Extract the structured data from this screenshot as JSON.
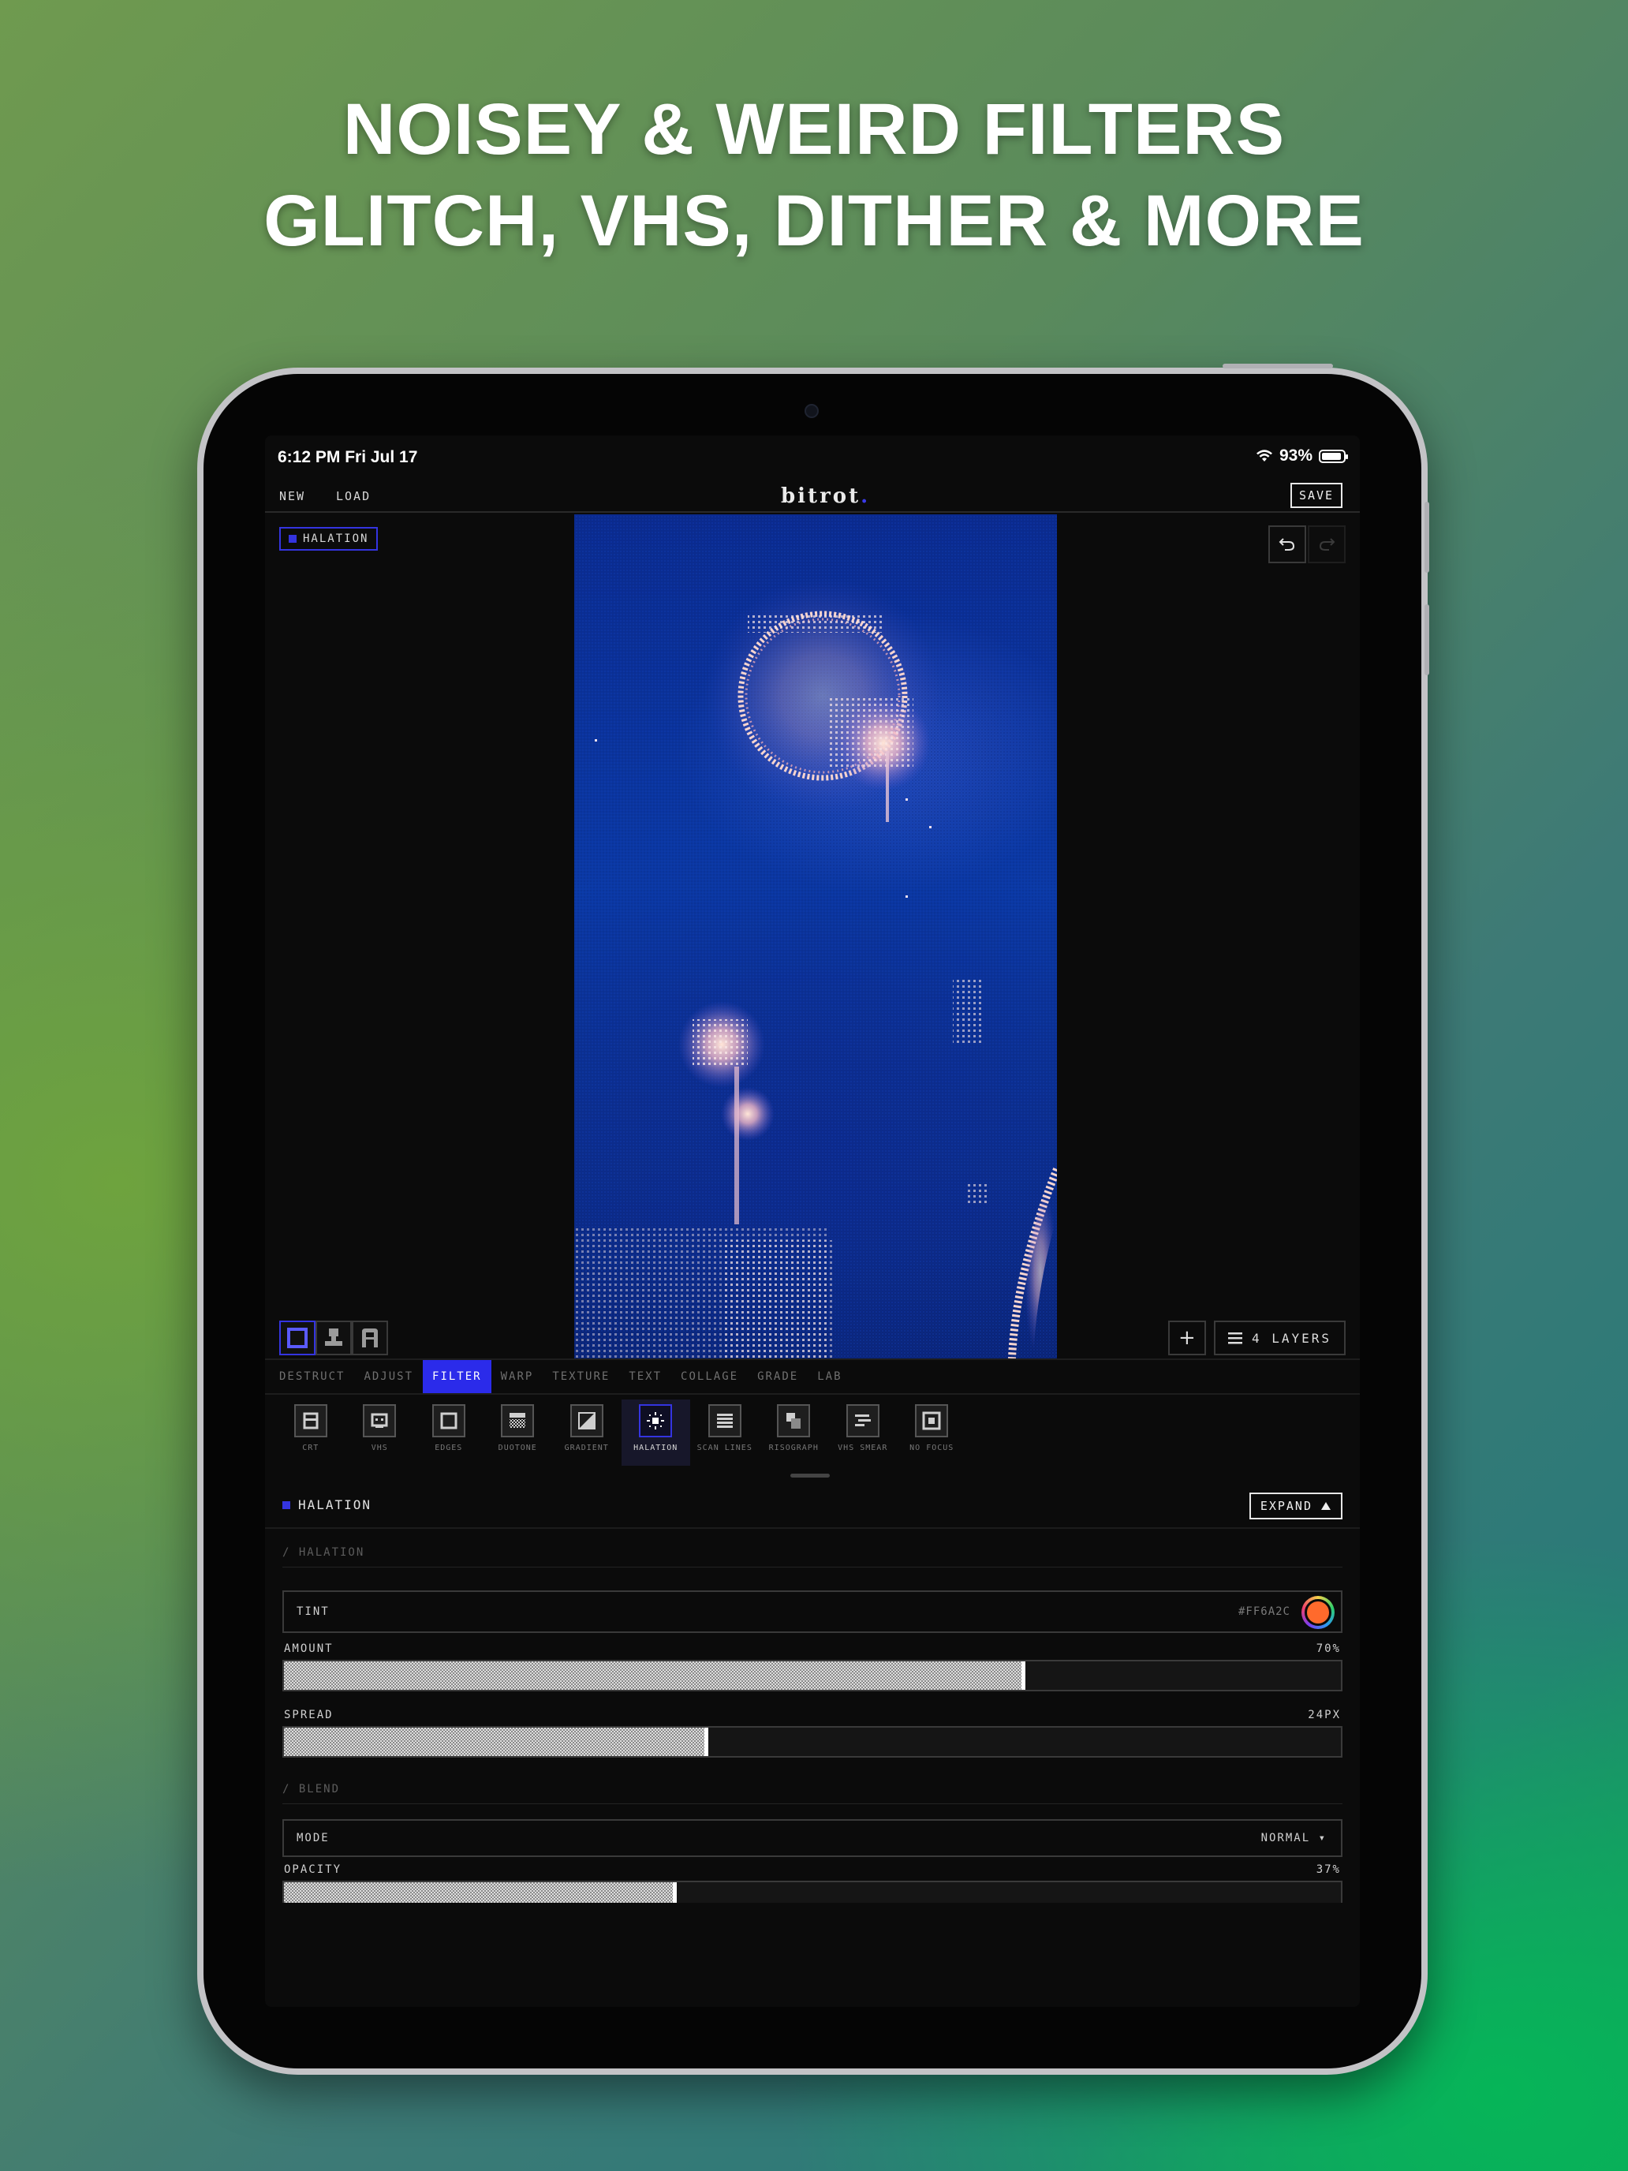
{
  "headline": {
    "line1": "NOISEY & WEIRD FILTERS",
    "line2": "GLITCH, VHS, DITHER & MORE"
  },
  "status_bar": {
    "time": "6:12 PM  Fri Jul 17",
    "battery": "93%",
    "battery_level": 0.93
  },
  "menubar": {
    "new_label": "NEW",
    "load_label": "LOAD",
    "logo": "bitrot",
    "logo_dot": ".",
    "save_label": "SAVE"
  },
  "canvas": {
    "active_layer_badge": "HALATION",
    "undo_icon": "undo-icon",
    "redo_icon": "redo-icon",
    "view_modes": [
      "canvas-mode-icon",
      "stamp-mode-icon",
      "portrait-mode-icon"
    ],
    "add_label": "+",
    "layers_label": "4 LAYERS"
  },
  "tabs": [
    {
      "label": "DESTRUCT",
      "active": false
    },
    {
      "label": "ADJUST",
      "active": false
    },
    {
      "label": "FILTER",
      "active": true
    },
    {
      "label": "WARP",
      "active": false
    },
    {
      "label": "TEXTURE",
      "active": false
    },
    {
      "label": "TEXT",
      "active": false
    },
    {
      "label": "COLLAGE",
      "active": false
    },
    {
      "label": "GRADE",
      "active": false
    },
    {
      "label": "LAB",
      "active": false
    }
  ],
  "filters": [
    {
      "label": "CRT",
      "icon": "crt-icon",
      "active": false
    },
    {
      "label": "VHS",
      "icon": "vhs-icon",
      "active": false
    },
    {
      "label": "EDGES",
      "icon": "edges-icon",
      "active": false
    },
    {
      "label": "DUOTONE",
      "icon": "duotone-icon",
      "active": false
    },
    {
      "label": "GRADIENT",
      "icon": "gradient-icon",
      "active": false
    },
    {
      "label": "HALATION",
      "icon": "halation-icon",
      "active": true
    },
    {
      "label": "SCAN LINES",
      "icon": "scan-lines-icon",
      "active": false
    },
    {
      "label": "RISOGRAPH",
      "icon": "risograph-icon",
      "active": false
    },
    {
      "label": "VHS SMEAR",
      "icon": "vhs-smear-icon",
      "active": false
    },
    {
      "label": "NO FOCUS",
      "icon": "no-focus-icon",
      "active": false
    }
  ],
  "panel": {
    "title": "HALATION",
    "expand_label": "EXPAND",
    "section_halation": "/ HALATION",
    "tint_label": "TINT",
    "tint_hex": "#FF6A2C",
    "tint_color": "#FF6A2C",
    "amount_label": "AMOUNT",
    "amount_value": "70%",
    "amount_fraction": 0.7,
    "spread_label": "SPREAD",
    "spread_value": "24PX",
    "spread_fraction": 0.4,
    "section_blend": "/ BLEND",
    "mode_label": "MODE",
    "mode_value": "NORMAL ▾",
    "opacity_label": "OPACITY",
    "opacity_value": "37%",
    "opacity_fraction": 0.37
  },
  "colors": {
    "accent": "#2B2BEA",
    "background": "#0B0B0B"
  }
}
